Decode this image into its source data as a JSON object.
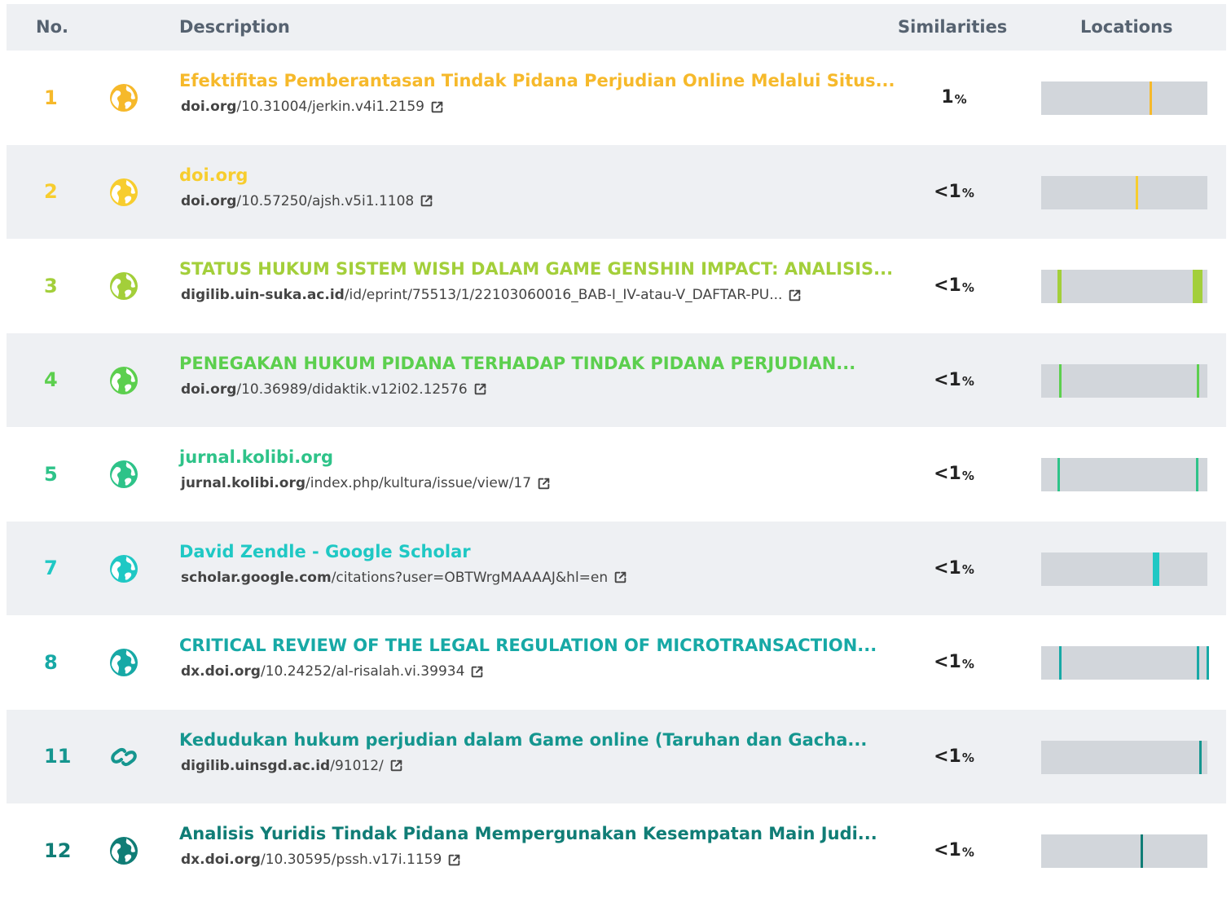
{
  "header": {
    "no": "No.",
    "description": "Description",
    "similarities": "Similarities",
    "locations": "Locations"
  },
  "rows": [
    {
      "no": "1",
      "color": "#f6b92b",
      "icon": "globe-icon",
      "title": "Efektifitas Pemberantasan Tindak Pidana Perjudian Online Melalui Situs...",
      "domain": "doi.org",
      "path": "/10.31004/jerkin.v4i1.2159",
      "sim": "1",
      "pct": "%",
      "marks": [
        0.65
      ]
    },
    {
      "no": "2",
      "color": "#f7cd2e",
      "icon": "globe-icon",
      "title": "doi.org",
      "domain": "doi.org",
      "path": "/10.57250/ajsh.v5i1.1108",
      "sim": "<1",
      "pct": "%",
      "marks": [
        0.57
      ]
    },
    {
      "no": "3",
      "color": "#a3cf3a",
      "icon": "globe-icon",
      "title": "STATUS HUKUM SISTEM WISH DALAM GAME GENSHIN IMPACT: ANALISIS...",
      "domain": "digilib.uin-suka.ac.id",
      "path": "/id/eprint/75513/1/22103060016_BAB-I_IV-atau-V_DAFTAR-PU...",
      "sim": "<1",
      "pct": "%",
      "marks": [
        0.1,
        0.11,
        0.91,
        0.925,
        0.94,
        0.955
      ]
    },
    {
      "no": "4",
      "color": "#5ccf4e",
      "icon": "globe-icon",
      "title": "PENEGAKAN HUKUM PIDANA TERHADAP TINDAK PIDANA PERJUDIAN...",
      "domain": "doi.org",
      "path": "/10.36989/didaktik.v12i02.12576",
      "sim": "<1",
      "pct": "%",
      "marks": [
        0.11,
        0.935
      ]
    },
    {
      "no": "5",
      "color": "#2ec389",
      "icon": "globe-icon",
      "title": "jurnal.kolibi.org",
      "domain": "jurnal.kolibi.org",
      "path": "/index.php/kultura/issue/view/17",
      "sim": "<1",
      "pct": "%",
      "marks": [
        0.1,
        0.93
      ]
    },
    {
      "no": "7",
      "color": "#1fc8c4",
      "icon": "globe-icon",
      "title": "David Zendle - Google Scholar",
      "domain": "scholar.google.com",
      "path": "/citations?user=OBTWrgMAAAAJ&hl=en",
      "sim": "<1",
      "pct": "%",
      "marks": [
        0.67,
        0.68,
        0.695
      ]
    },
    {
      "no": "8",
      "color": "#17a9a6",
      "icon": "globe-icon",
      "title": "CRITICAL REVIEW OF THE LEGAL REGULATION OF MICROTRANSACTION...",
      "domain": "dx.doi.org",
      "path": "/10.24252/al-risalah.vi.39934",
      "sim": "<1",
      "pct": "%",
      "marks": [
        0.11,
        0.935,
        0.995
      ]
    },
    {
      "no": "11",
      "color": "#15968f",
      "icon": "link-icon",
      "title": "Kedudukan hukum perjudian dalam Game online (Taruhan dan Gacha...",
      "domain": "digilib.uinsgd.ac.id",
      "path": "/91012/",
      "sim": "<1",
      "pct": "%",
      "marks": [
        0.95
      ]
    },
    {
      "no": "12",
      "color": "#107d76",
      "icon": "globe-icon",
      "title": "Analisis Yuridis Tindak Pidana Mempergunakan Kesempatan Main Judi...",
      "domain": "dx.doi.org",
      "path": "/10.30595/pssh.v17i.1159",
      "sim": "<1",
      "pct": "%",
      "marks": [
        0.6
      ]
    }
  ]
}
